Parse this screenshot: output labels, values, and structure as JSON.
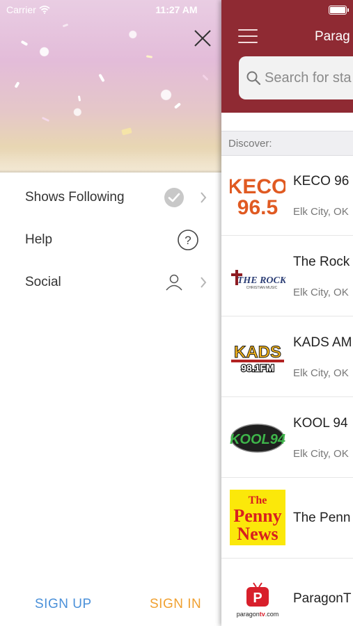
{
  "status_bar": {
    "carrier": "Carrier",
    "time": "11:27 AM"
  },
  "drawer": {
    "menu": [
      {
        "label": "Shows Following",
        "icon": "check-circle-icon"
      },
      {
        "label": "Help",
        "icon": "question-circle-icon"
      },
      {
        "label": "Social",
        "icon": "person-icon"
      }
    ],
    "sign_up": "SIGN UP",
    "sign_in": "SIGN IN"
  },
  "main": {
    "title": "Parag",
    "search_placeholder": "Search for sta",
    "section_header": "Discover:",
    "stations": [
      {
        "name": "KECO 96",
        "location": "Elk City, OK",
        "logo_text": "KECO 96.5"
      },
      {
        "name": "The Rock",
        "location": "Elk City, OK",
        "logo_text": "THE ROCK"
      },
      {
        "name": "KADS AM",
        "location": "Elk City, OK",
        "logo_text": "KADS 98.1FM"
      },
      {
        "name": "KOOL 94",
        "location": "Elk City, OK",
        "logo_text": "KOOL94"
      },
      {
        "name": "The Penn",
        "location": "",
        "logo_text": "The Penny News"
      },
      {
        "name": "ParagonT",
        "location": "",
        "logo_text": "paragontv.com"
      }
    ]
  },
  "colors": {
    "navbar": "#8f2a33",
    "sign_up": "#4a90d9",
    "sign_in": "#f0a030"
  }
}
